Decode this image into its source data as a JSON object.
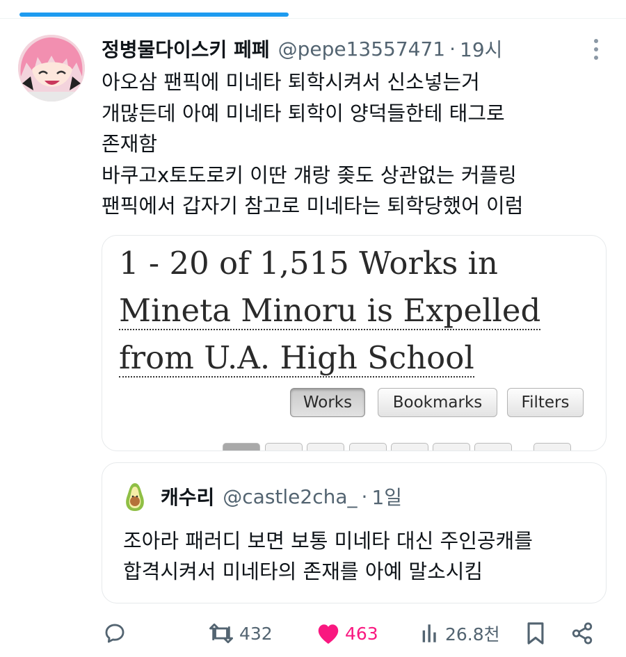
{
  "colors": {
    "accent": "#1d9bf0",
    "like": "#f91880",
    "secondary_text": "#536471"
  },
  "video_progress": 0.43,
  "tweet": {
    "display_name": "정병물다이스키 페페",
    "handle": "@pepe13557471",
    "separator": "·",
    "time": "19시",
    "text_lines": [
      "아오삼 팬픽에 미네타 퇴학시켜서 신소넣는거",
      "개많든데 아예 미네타 퇴학이 양덕들한테 태그로",
      "존재함",
      "바쿠고x토도로키 이딴 걔랑 좆도 상관없는 커플링",
      "팬픽에서 갑자기 참고로 미네타는 퇴학당했어 이럼"
    ]
  },
  "media": {
    "heading_prefix": "1 - 20 of 1,515 Works in",
    "tag_line1": "Mineta Minoru is Expelled",
    "tag_line2": "from U.A. High School",
    "buttons": {
      "works": "Works",
      "bookmarks": "Bookmarks",
      "filters": "Filters"
    }
  },
  "quote": {
    "display_name": "캐수리",
    "handle": "@castle2cha_",
    "separator": "·",
    "time": "1일",
    "text_lines": [
      "조아라 패러디 보면 보통 미네타 대신 주인공캐를",
      "합격시켜서 미네타의 존재를 아예 말소시킴"
    ]
  },
  "actions": {
    "reply_icon": "reply-icon",
    "retweet_count": "432",
    "like_count": "463",
    "views_count": "26.8천",
    "bookmark_icon": "bookmark-icon",
    "share_icon": "share-icon"
  }
}
